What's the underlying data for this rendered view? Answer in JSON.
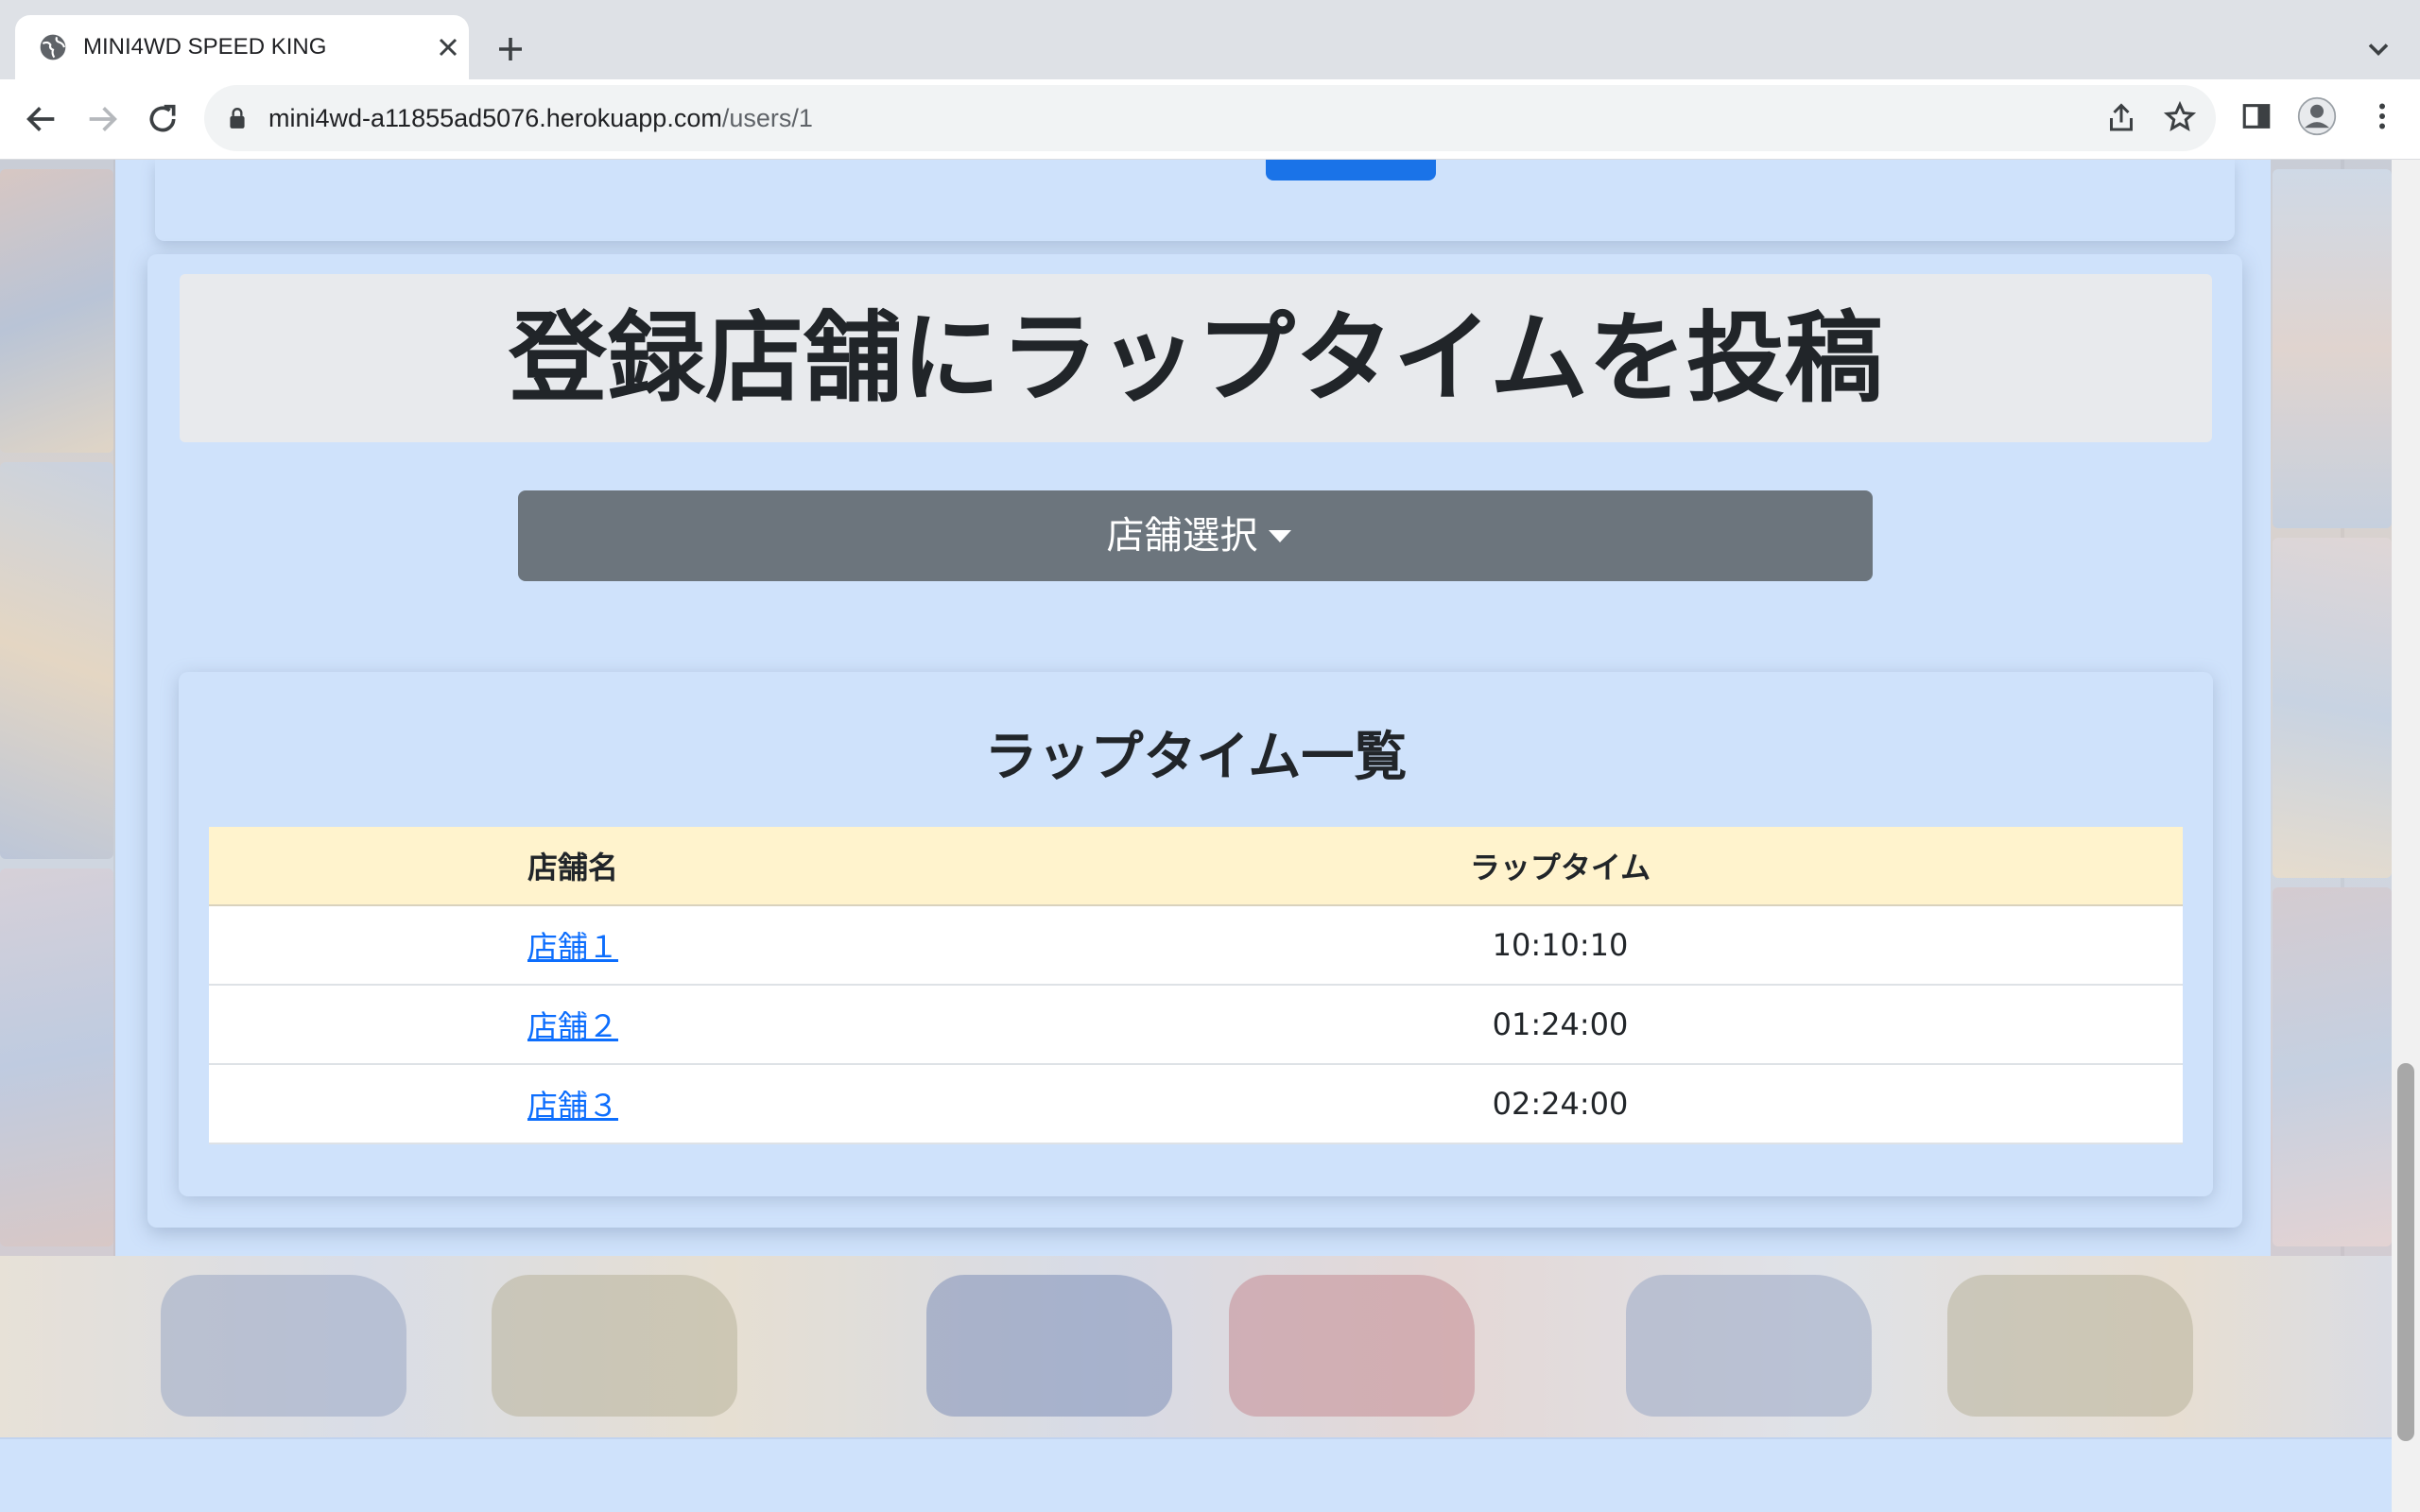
{
  "browser": {
    "tab_title": "MINI4WD SPEED KING",
    "url_host": "mini4wd-a11855ad5076.herokuapp.com",
    "url_path": "/users/1"
  },
  "page": {
    "heading": "登録店舗にラップタイムを投稿",
    "store_select_label": "店舗選択",
    "lap_list": {
      "title": "ラップタイム一覧",
      "columns": [
        "店舗名",
        "ラップタイム"
      ],
      "rows": [
        {
          "store": "店舗１",
          "lap_time": "10:10:10"
        },
        {
          "store": "店舗２",
          "lap_time": "01:24:00"
        },
        {
          "store": "店舗３",
          "lap_time": "02:24:00"
        }
      ]
    }
  },
  "colors": {
    "page_bg": "#cfe2fb",
    "dropdown_bg": "#6c757d",
    "table_header_bg": "#fff3cd",
    "link": "#0d6efd",
    "top_button": "#1a73e8"
  },
  "icons": [
    "globe-icon",
    "close-icon",
    "plus-icon",
    "chevron-down-icon",
    "back-arrow-icon",
    "forward-arrow-icon",
    "reload-icon",
    "lock-icon",
    "share-icon",
    "star-icon",
    "side-panel-icon",
    "profile-icon",
    "kebab-menu-icon",
    "caret-down-icon"
  ]
}
